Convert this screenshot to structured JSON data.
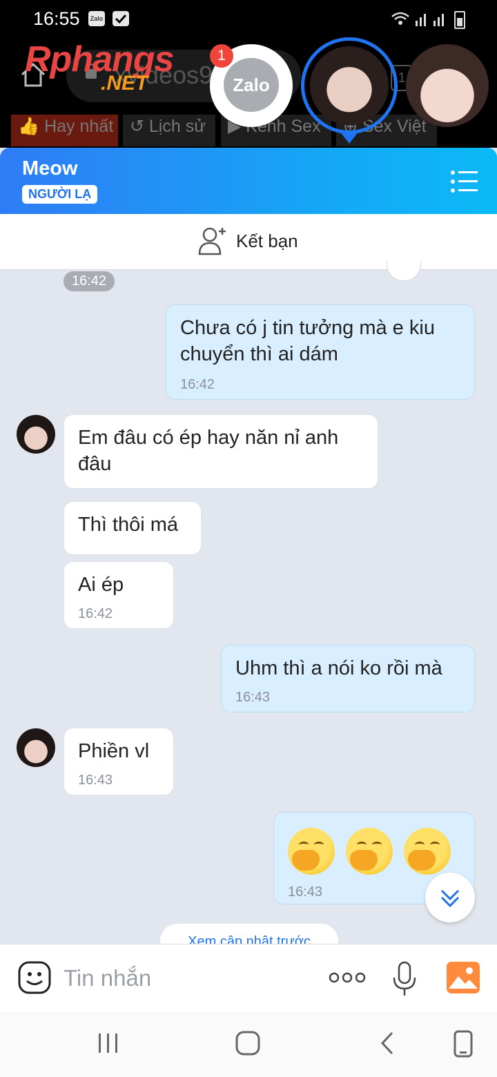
{
  "status_bar": {
    "time": "16:55",
    "zalo_icon": "Zalo"
  },
  "browser": {
    "url": "xvideos9",
    "logo_main": "Rphangs",
    "logo_sub": ".NET",
    "tab_count": "1",
    "tabs": [
      "Hay nhất",
      "Lịch sử",
      "Kênh Sex",
      "Sex Việt"
    ]
  },
  "chat_heads": {
    "zalo_label": "Zalo",
    "zalo_badge": "1"
  },
  "header": {
    "contact_name": "Meow",
    "badge": "NGƯỜI LẠ"
  },
  "add_friend": {
    "label": "Kết bạn"
  },
  "messages": {
    "top_time": "16:42",
    "m1": {
      "line1": "Chưa có j tin tưởng mà e kiu",
      "line2": "chuyển thì ai dám",
      "time": "16:42"
    },
    "m2": {
      "line1": "Em đâu có ép hay năn nỉ anh",
      "line2": "đâu"
    },
    "m3": {
      "text": "Thì thôi má"
    },
    "m4": {
      "text": "Ai ép",
      "time": "16:42"
    },
    "m5": {
      "text": "Uhm thì a nói ko rồi mà",
      "time": "16:43"
    },
    "m6": {
      "text": "Phiền vl",
      "time": "16:43"
    },
    "m7": {
      "emoji_name": "face-with-hand-over-mouth",
      "time": "16:43"
    }
  },
  "load_more": "Xem cập nhật trước",
  "composer": {
    "placeholder": "Tin nhắn"
  },
  "colors": {
    "accent": "#1f73e8",
    "header_start": "#2f7cf6",
    "header_end": "#0bb9f6",
    "outgoing_bubble": "#d9efff"
  }
}
